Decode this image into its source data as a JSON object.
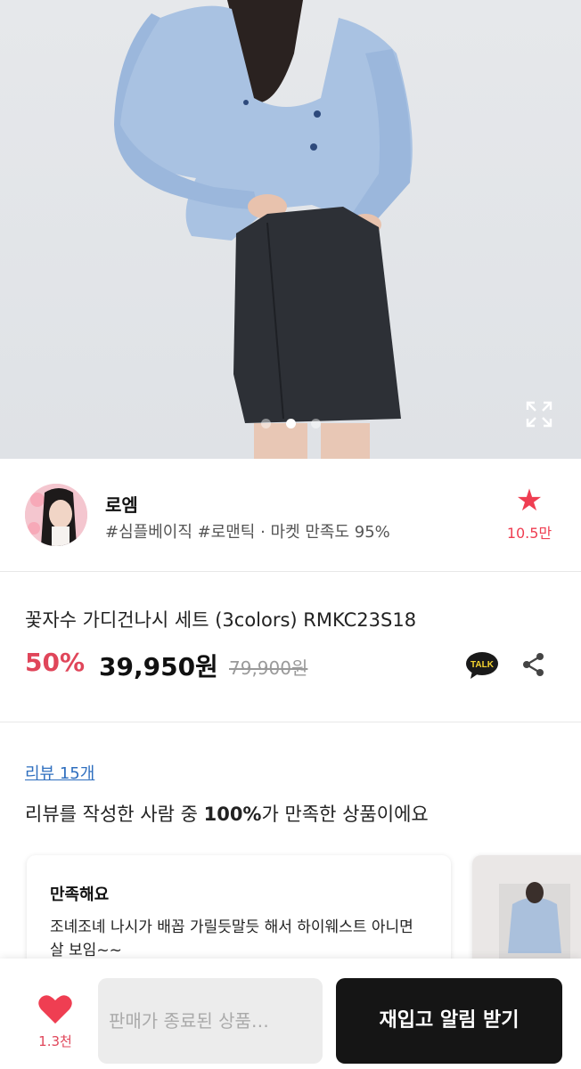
{
  "hero": {
    "dots_count": 3,
    "active_dot": 2
  },
  "shop": {
    "name": "로엠",
    "tags": "#심플베이직 #로맨틱 · 마켓 만족도 95%",
    "favorite_count": "10.5만"
  },
  "product": {
    "title": "꽃자수 가디건나시 세트 (3colors) RMKC23S18",
    "discount": "50%",
    "price": "39,950원",
    "original_price": "79,900원",
    "talk_label": "TALK"
  },
  "reviews": {
    "link": "리뷰 15개",
    "summary_prefix": "리뷰를 작성한 사람 중 ",
    "summary_bold": "100%",
    "summary_suffix": "가 만족한 상품이에요",
    "card": {
      "title": "만족해요",
      "body": "조녜조녜 나시가 배꼽 가릴듯말듯 해서 하이웨스트 아니면 살 보임~~"
    }
  },
  "bottom": {
    "like_count": "1.3천",
    "soldout_label": "판매가 종료된 상품…",
    "notify_label": "재입고 알림 받기"
  },
  "colors": {
    "accent": "#ef3e52",
    "discount": "#e0465a",
    "link": "#2f6fbf"
  }
}
